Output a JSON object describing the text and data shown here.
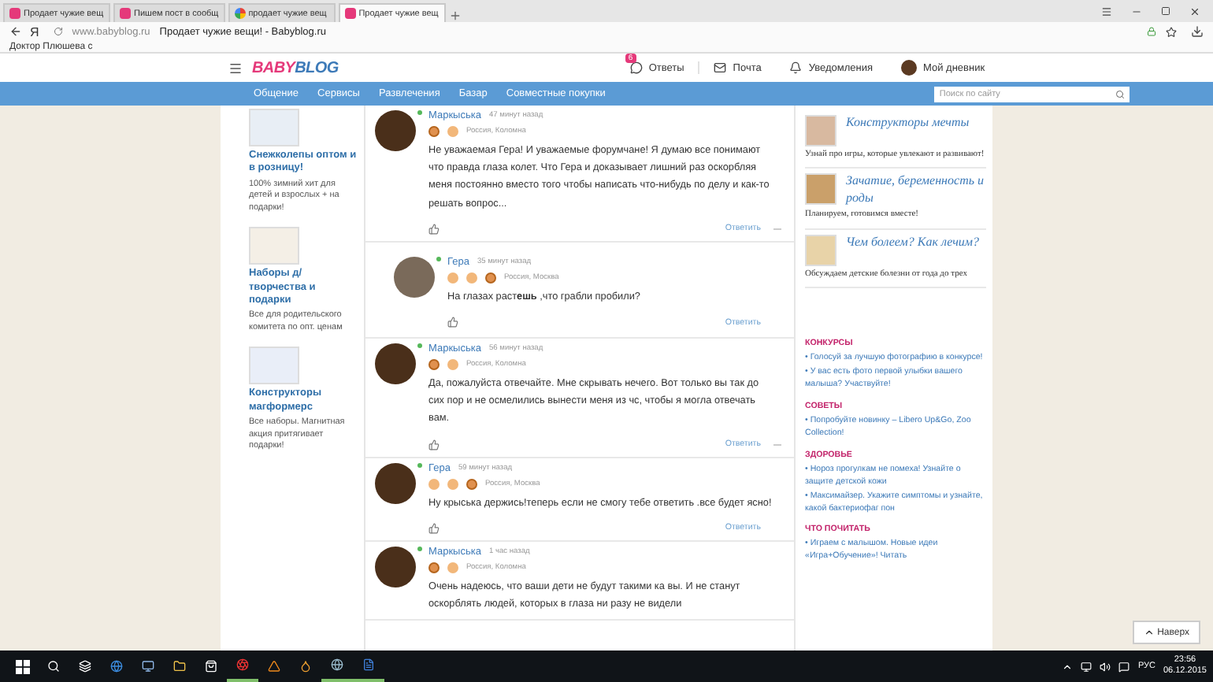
{
  "browser": {
    "tabs": [
      {
        "title": "Продает чужие вещ",
        "kind": "babyblog",
        "selected": false
      },
      {
        "title": "Пишем пост в сообщ",
        "kind": "babyblog",
        "selected": false
      },
      {
        "title": "продает чужие вещ",
        "kind": "google",
        "selected": false
      },
      {
        "title": "Продает чужие вещ",
        "kind": "babyblog",
        "selected": true
      }
    ],
    "yandex_button": "Я",
    "url": "www.babyblog.ru",
    "page_title": "Продает чужие вещи! - Babyblog.ru",
    "bookmarks": [
      "Доктор Плюшева с"
    ]
  },
  "header": {
    "logo": [
      "BABY",
      "BLOG"
    ],
    "items": [
      {
        "kind": "answers",
        "label": "Ответы",
        "badge": "6"
      },
      {
        "kind": "mail",
        "label": "Почта"
      },
      {
        "kind": "bell",
        "label": "Уведомления"
      },
      {
        "kind": "avatar",
        "label": "Мой дневник"
      }
    ],
    "nav": [
      "Общение",
      "Сервисы",
      "Развлечения",
      "Базар",
      "Совместные покупки"
    ],
    "search": {
      "placeholder": "Поиск по сайту"
    }
  },
  "left_ads": [
    {
      "title": "Снежколепы оптом и в розницу!",
      "text": "100% зимний хит для детей и взрослых + на подарки!"
    },
    {
      "title": "Наборы д/творчества и подарки",
      "text": "Все для родительского комитета по опт. ценам"
    },
    {
      "title": "Конструкторы магформерс",
      "text": "Все наборы. Магнитная акция притягивает подарки!"
    }
  ],
  "comments": [
    {
      "author": "Маркыська",
      "time": "47 минут назад",
      "online": true,
      "nested": false,
      "kids": [
        {
          "kind": "girl"
        },
        {
          "kind": "boy"
        }
      ],
      "location": "Россия, Коломна",
      "text": "Не уважаемая Гера! И уважаемые форумчане! Я думаю все понимают что правда глаза колет. Что Гера и доказывает лишний раз оскорбляя меня постоянно вместо того чтобы написать что-нибудь по делу и как-то решать вопрос...",
      "reply": "Ответить",
      "menu": true
    },
    {
      "author": "Гера",
      "time": "35 минут назад",
      "online": true,
      "nested": true,
      "kids": [
        {
          "kind": "boy"
        },
        {
          "kind": "boy"
        },
        {
          "kind": "girl"
        }
      ],
      "location": "Россия, Москва",
      "text": "На глазах раст**ешь** ,что грабли пробили?",
      "reply": "Ответить",
      "menu": false
    },
    {
      "author": "Маркыська",
      "time": "56 минут назад",
      "online": true,
      "nested": false,
      "kids": [
        {
          "kind": "girl"
        },
        {
          "kind": "boy"
        }
      ],
      "location": "Россия, Коломна",
      "text": "Да, пожалуйста отвечайте. Мне скрывать нечего. Вот только вы так до сих пор и не осмелились вынести меня из чс, чтобы я могла отвечать вам.",
      "reply": "Ответить",
      "menu": true
    },
    {
      "author": "Гера",
      "time": "59 минут назад",
      "online": true,
      "nested": false,
      "kids": [
        {
          "kind": "boy"
        },
        {
          "kind": "boy"
        },
        {
          "kind": "girl"
        }
      ],
      "location": "Россия, Москва",
      "text": "Ну крыська держись!теперь если не смогу тебе ответить .все будет ясно!",
      "reply": "Ответить",
      "menu": false
    },
    {
      "author": "Маркыська",
      "time": "1 час назад",
      "online": true,
      "nested": false,
      "kids": [
        {
          "kind": "girl"
        },
        {
          "kind": "boy"
        }
      ],
      "location": "Россия, Коломна",
      "text": "Очень надеюсь, что ваши дети не будут такими ка вы. И не станут оскорблять людей, которых в глаза ни разу не видели"
    }
  ],
  "right_promos": [
    {
      "title": "Конструкторы мечты",
      "text": "Узнай про игры, которые увлекают и развивают!"
    },
    {
      "title": "Зачатие, беременность и роды",
      "text": "Планируем, готовимся вместе!"
    },
    {
      "title": "Чем болеем? Как лечим?",
      "text": "Обсуждаем детские болезни от года до трех"
    }
  ],
  "right_sections": [
    {
      "heading": "КОНКУРСЫ",
      "links": [
        "• Голосуй за лучшую фотографию в конкурсе!",
        "• У вас есть фото первой улыбки вашего малыша? Участвуйте!"
      ]
    },
    {
      "heading": "СОВЕТЫ",
      "links": [
        "• Попробуйте новинку – Libero Up&Go, Zoo Collection!"
      ]
    },
    {
      "heading": "ЗДОРОВЬЕ",
      "links": [
        "• Нороз прогулкам не помеха! Узнайте о защите детской кожи",
        "• Максимайзер. Укажите симптомы и узнайте, какой бактериофаг пон"
      ]
    },
    {
      "heading": "ЧТО ПОЧИТАТЬ",
      "links": [
        "• Играем с малышом. Новые идеи «Игра+Обучение»! Читать"
      ]
    }
  ],
  "to_top": "Наверх",
  "taskbar": {
    "lang": "РУС",
    "time": "23:56",
    "date": "06.12.2015"
  }
}
